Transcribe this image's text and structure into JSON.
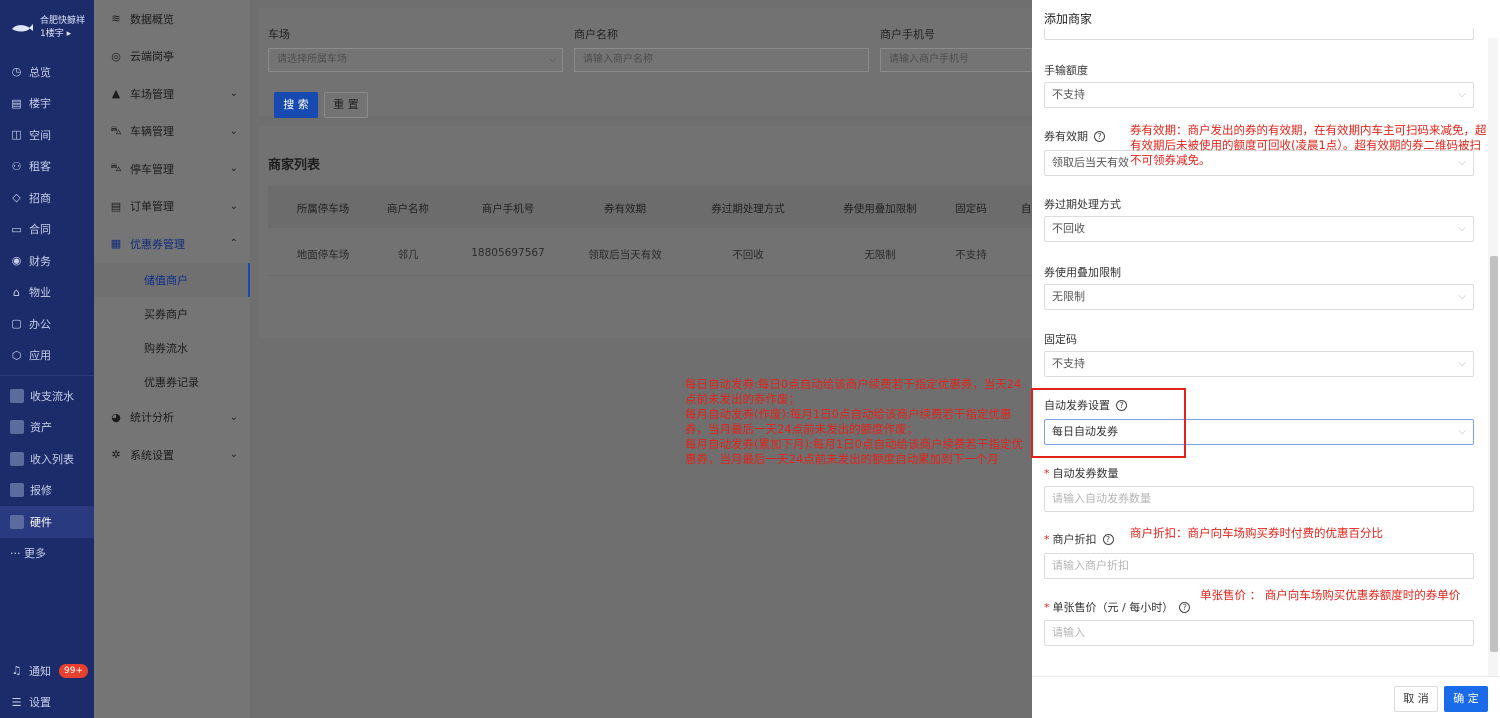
{
  "brand": {
    "title": "合肥快鲸祥",
    "building": "1楼宇",
    "arrow": "▸"
  },
  "nav": {
    "items": [
      {
        "icon": "◷",
        "label": "总览"
      },
      {
        "icon": "▤",
        "label": "楼宇"
      },
      {
        "icon": "◫",
        "label": "空间"
      },
      {
        "icon": "⚇",
        "label": "租客"
      },
      {
        "icon": "◇",
        "label": "招商"
      },
      {
        "icon": "▭",
        "label": "合同"
      },
      {
        "icon": "◉",
        "label": "财务"
      },
      {
        "icon": "⌂",
        "label": "物业"
      },
      {
        "icon": "▢",
        "label": "办公"
      },
      {
        "icon": "⬡",
        "label": "应用"
      }
    ],
    "apps": [
      {
        "label": "收支流水"
      },
      {
        "label": "资产"
      },
      {
        "label": "收入列表"
      },
      {
        "label": "报修"
      },
      {
        "label": "硬件"
      }
    ],
    "more": "··· 更多",
    "notice_label": "通知",
    "notice_badge": "99+",
    "settings_label": "设置"
  },
  "submenu": {
    "items": [
      {
        "icon": "≋",
        "label": "数据概览"
      },
      {
        "icon": "◎",
        "label": "云端岗亭"
      },
      {
        "icon": "▲",
        "label": "车场管理",
        "chev": "⌄"
      },
      {
        "icon": "⛍",
        "label": "车辆管理",
        "chev": "⌄"
      },
      {
        "icon": "⛍",
        "label": "停车管理",
        "chev": "⌄"
      },
      {
        "icon": "▤",
        "label": "订单管理",
        "chev": "⌄"
      },
      {
        "icon": "▦",
        "label": "优惠券管理",
        "chev": "⌃"
      }
    ],
    "children": [
      "储值商户",
      "买券商户",
      "购券流水",
      "优惠券记录"
    ],
    "after": [
      {
        "icon": "◕",
        "label": "统计分析",
        "chev": "⌄"
      },
      {
        "icon": "✲",
        "label": "系统设置",
        "chev": "⌄"
      }
    ]
  },
  "filter": {
    "lot_label": "车场",
    "lot_placeholder": "请选择所属车场",
    "name_label": "商户名称",
    "name_placeholder": "请输入商户名称",
    "phone_label": "商户手机号",
    "phone_placeholder": "请输入商户手机号",
    "search_btn": "搜 索",
    "reset_btn": "重 置"
  },
  "list": {
    "title": "商家列表",
    "headers": [
      "所属停车场",
      "商户名称",
      "商户手机号",
      "券有效期",
      "券过期处理方式",
      "券使用叠加限制",
      "固定码",
      "自"
    ],
    "rows": [
      [
        "地面停车场",
        "邻几",
        "18805697567",
        "领取后当天有效",
        "不回收",
        "无限制",
        "不支持"
      ]
    ]
  },
  "annotations": {
    "auto_issue": "每日自动发券:每日0点自动给该商户续费若干指定优惠券，当天24点前未发出的券作废；\n每月自动发券(作废):每月1日0点自动给该商户续费若干指定优惠券，当月最后一天24点前未发出的额度作废；\n每月自动发券(累加下月):每月1日0点自动给该商户续费若干指定优惠券，当月最后一天24点前未发出的额度自动累加到下一个月",
    "validity": "券有效期：商户发出的券的有效期，在有效期内车主可扫码来减免，超有效期后未被使用的额度可回收(凌晨1点）。超有效期的券二维码被扫不可领券减免。",
    "discount": "商户折扣：商户向车场购买券时付费的优惠百分比",
    "price": "单张售价 ：  商户向车场购买优惠券额度时的券单价"
  },
  "drawer": {
    "title": "添加商家",
    "manual_label": "手输额度",
    "manual_value": "不支持",
    "validity_label": "券有效期",
    "validity_value": "领取后当天有效",
    "expire_label": "券过期处理方式",
    "expire_value": "不回收",
    "stack_label": "券使用叠加限制",
    "stack_value": "无限制",
    "fixed_label": "固定码",
    "fixed_value": "不支持",
    "auto_label": "自动发券设置",
    "auto_value": "每日自动发券",
    "qty_label": "自动发券数量",
    "qty_placeholder": "请输入自动发券数量",
    "discount_label": "商户折扣",
    "discount_placeholder": "请输入商户折扣",
    "price_label": "单张售价（元 / 每小时）",
    "price_placeholder": "请输入",
    "required_mark": "*",
    "help_icon": "?",
    "dropdown_icon": "⌵",
    "cancel": "取 消",
    "ok": "确 定"
  },
  "colors": {
    "nav_bg": "#1c2c6b",
    "primary": "#1a6bea",
    "annotation": "#e2231a"
  }
}
